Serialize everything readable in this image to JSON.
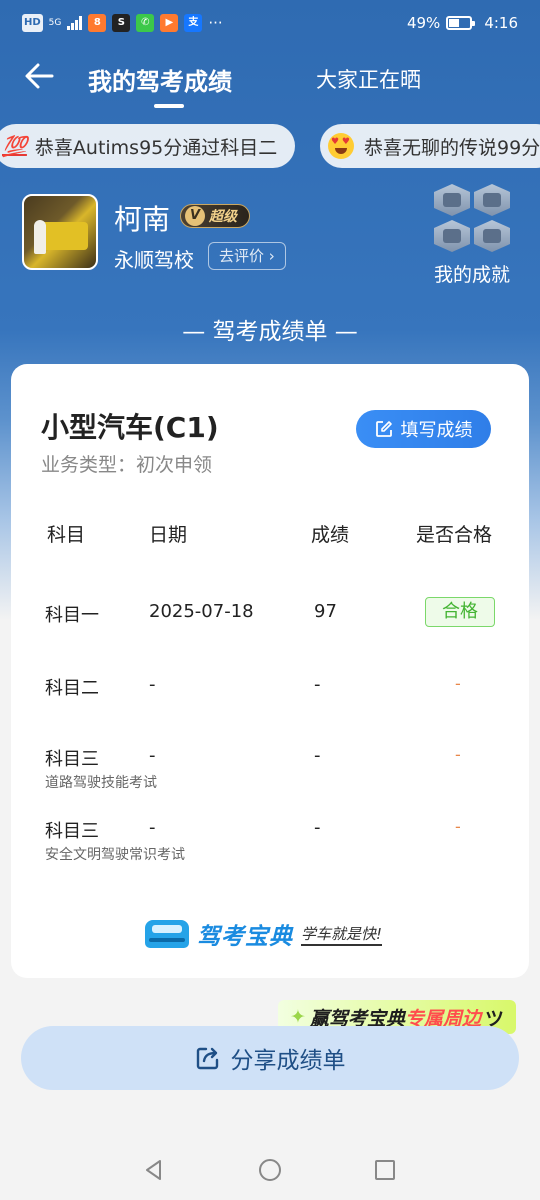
{
  "status_bar": {
    "left_labels": [
      "HD",
      "5G"
    ],
    "battery_percent": "49%",
    "battery_level": 0.49,
    "time": "4:16",
    "more": "···"
  },
  "nav": {
    "active_tab": "我的驾考成绩",
    "other_tab": "大家正在晒"
  },
  "marquee": [
    {
      "icon": "💯",
      "text": "恭喜Autims95分通过科目二"
    },
    {
      "icon": "heart-eyes-emoji",
      "text": "恭喜无聊的传说99分"
    }
  ],
  "profile": {
    "name": "柯南",
    "vip_label": "超级",
    "vip_letter": "V",
    "school": "永顺驾校",
    "rate_button": "去评价",
    "achievements_label": "我的成就"
  },
  "section_title": "— 驾考成绩单 —",
  "card": {
    "license_type": "小型汽车(C1)",
    "business_type": "业务类型：初次申领",
    "fill_button": "填写成绩",
    "headers": [
      "科目",
      "日期",
      "成绩",
      "是否合格"
    ],
    "rows": [
      {
        "subject": "科目一",
        "sub_label": "",
        "date": "2025-07-18",
        "score": "97",
        "result": "合格"
      },
      {
        "subject": "科目二",
        "sub_label": "",
        "date": "-",
        "score": "-",
        "result": "-"
      },
      {
        "subject": "科目三",
        "sub_label": "道路驾驶技能考试",
        "date": "-",
        "score": "-",
        "result": "-"
      },
      {
        "subject": "科目三",
        "sub_label": "安全文明驾驶常识考试",
        "date": "-",
        "score": "-",
        "result": "-"
      }
    ],
    "brand_name": "驾考宝典",
    "brand_slogan": "学车就是快!"
  },
  "promo": {
    "part1": "赢驾考宝典",
    "part2": "专属周边"
  },
  "share_button": "分享成绩单",
  "colors": {
    "header_blue": "#2f6bb2",
    "pass_green": "#44b433",
    "button_blue": "#3a8ef5",
    "pending_orange": "#e8874a"
  }
}
